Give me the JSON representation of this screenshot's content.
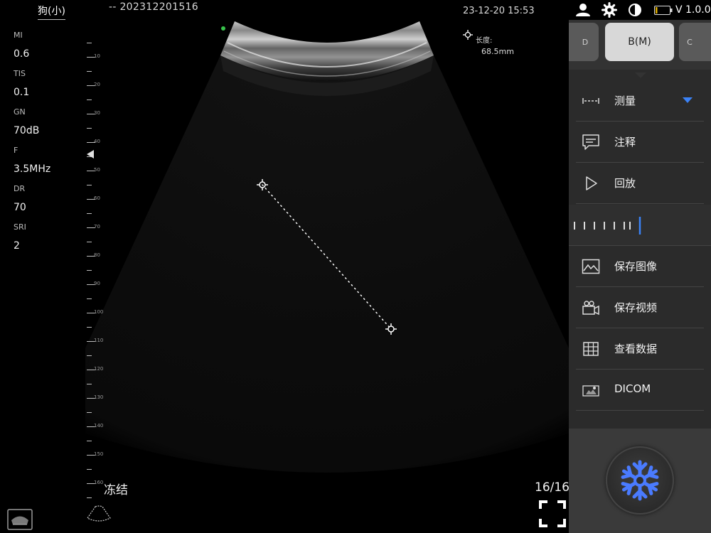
{
  "header": {
    "patient": "狗(小)",
    "study_id": "--  202312201516",
    "datetime": "23-12-20 15:53",
    "version": "V 1.0.0"
  },
  "params": [
    {
      "label": "MI",
      "value": "0.6"
    },
    {
      "label": "TIS",
      "value": "0.1"
    },
    {
      "label": "GN",
      "value": "70dB"
    },
    {
      "label": "F",
      "value": "3.5MHz"
    },
    {
      "label": "DR",
      "value": "70"
    },
    {
      "label": "SRI",
      "value": "2"
    }
  ],
  "depth_scale": {
    "labels": [
      "10",
      "20",
      "30",
      "40",
      "50",
      "60",
      "70",
      "80",
      "90",
      "100",
      "110",
      "120",
      "130",
      "140",
      "150",
      "160"
    ]
  },
  "measurement": {
    "label": "长度:",
    "value": "68.5mm"
  },
  "mode_tabs": [
    "D",
    "B(M)",
    "C"
  ],
  "active_mode": "B(M)",
  "menu": [
    {
      "label": "测量",
      "icon": "ruler-icon"
    },
    {
      "label": "注释",
      "icon": "annotation-icon"
    },
    {
      "label": "回放",
      "icon": "play-icon"
    },
    {
      "label": "保存图像",
      "icon": "image-icon"
    },
    {
      "label": "保存视频",
      "icon": "video-camera-icon"
    },
    {
      "label": "查看数据",
      "icon": "table-icon"
    },
    {
      "label": "DICOM",
      "icon": "dicom-icon"
    }
  ],
  "status": {
    "freeze_label": "冻结",
    "frame_counter": "16/16"
  },
  "colors": {
    "accent": "#3b82f6",
    "panel": "#2b2b2b",
    "freeze_icon": "#4a7bff"
  }
}
